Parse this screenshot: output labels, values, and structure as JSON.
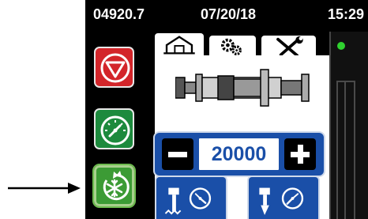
{
  "status": {
    "counter": "04920.7",
    "date": "07/20/18",
    "time": "15:29"
  },
  "stepper": {
    "value": "20000"
  },
  "icons": {
    "stop": "stop-triangle-icon",
    "cycle": "gauge-icon",
    "defrost": "snowflake-cycle-icon",
    "home": "home-icon",
    "settings": "gears-icon",
    "tools": "wrench-screwdriver-icon",
    "mode_a": "cooling-gauge-icon",
    "mode_b": "nozzle-gauge-icon"
  },
  "colors": {
    "stop": "#d3252a",
    "cycle": "#1d8a3d",
    "defrost": "#3c9b35",
    "accent_blue": "#1a4fa8",
    "indicator_green": "#2fd12f"
  }
}
